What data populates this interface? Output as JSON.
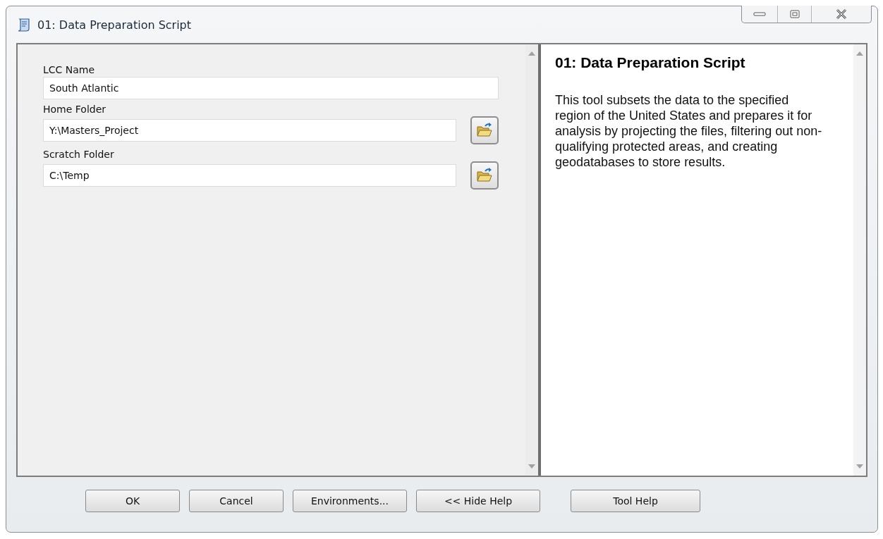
{
  "window": {
    "title": "01: Data Preparation Script"
  },
  "parameters": [
    {
      "label": "LCC Name",
      "value": "South Atlantic",
      "kind": "text"
    },
    {
      "label": "Home Folder",
      "value": "Y:\\Masters_Project",
      "kind": "folder"
    },
    {
      "label": "Scratch Folder",
      "value": "C:\\Temp",
      "kind": "folder"
    }
  ],
  "help": {
    "title": "01: Data Preparation Script",
    "body": "This tool subsets the data to the specified region of the United States and prepares it for analysis by projecting the files, filtering out non-qualifying protected areas, and creating geodatabases to store results."
  },
  "buttons": [
    {
      "label": "OK"
    },
    {
      "label": "Cancel"
    },
    {
      "label": "Environments..."
    },
    {
      "label": "<< Hide Help"
    },
    {
      "label": "Tool Help"
    }
  ]
}
